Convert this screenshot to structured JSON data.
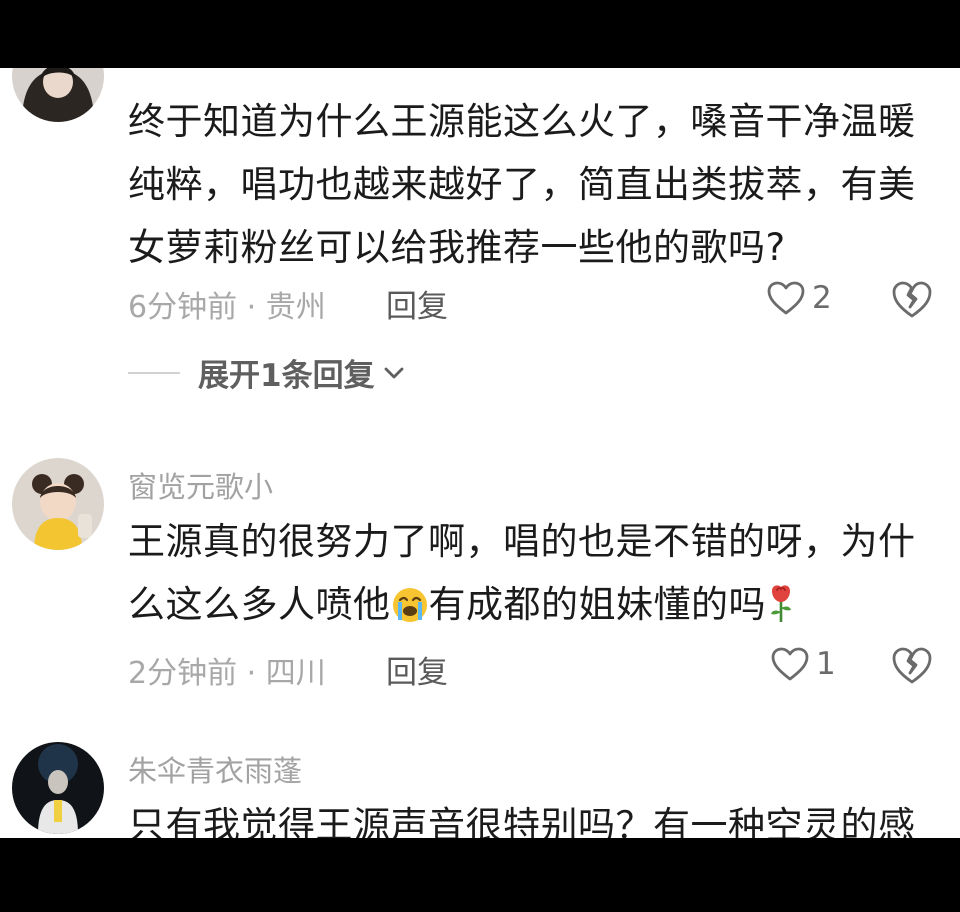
{
  "comments": [
    {
      "username": "",
      "text": "终于知道为什么王源能这么火了，嗓音干净温暖纯粹，唱功也越来越好了，简直出类拔萃，有美女萝莉粉丝可以给我推荐一些他的歌吗?",
      "time_location": "6分钟前 · 贵州",
      "reply_label": "回复",
      "likes": "2",
      "expand_label": "展开1条回复"
    },
    {
      "username": "窗览元歌小",
      "text_part1": "王源真的很努力了啊，唱的也是不错的呀，为什么这么多人喷他",
      "text_part2": "有成都的姐妹懂的吗",
      "time_location": "2分钟前 · 四川",
      "reply_label": "回复",
      "likes": "1"
    },
    {
      "username": "朱伞青衣雨蓬",
      "text": "只有我觉得王源声音很特别吗？有一种空灵的感"
    }
  ],
  "icons": {
    "like": "heart-outline-icon",
    "dislike": "broken-heart-icon",
    "expand": "chevron-down-icon",
    "crying_emoji": "crying-face-emoji",
    "rose_emoji": "rose-emoji"
  },
  "colors": {
    "background": "#ffffff",
    "text": "#1b1b1b",
    "muted": "#a8a8a8",
    "letterbox": "#000000"
  }
}
